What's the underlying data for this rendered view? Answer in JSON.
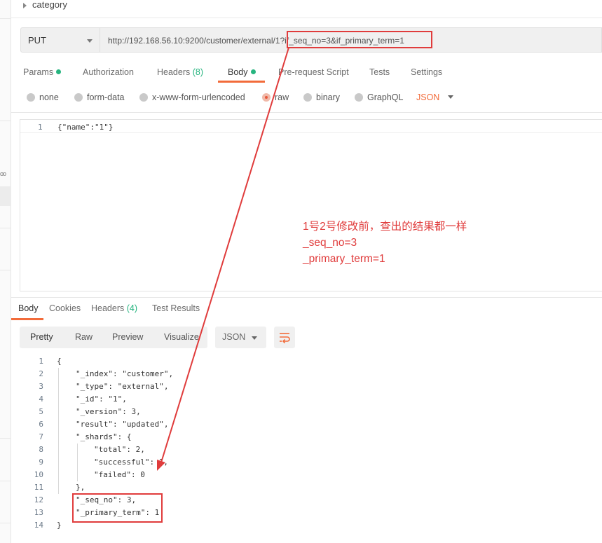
{
  "sidebar": {
    "collapsed_label": "oo"
  },
  "collection": {
    "label": "category"
  },
  "request": {
    "method": "PUT",
    "url": "http://192.168.56.10:9200/customer/external/1?if_seq_no=3&if_primary_term=1"
  },
  "request_tabs": [
    {
      "label": "Params",
      "dot": true
    },
    {
      "label": "Authorization"
    },
    {
      "label": "Headers",
      "count": "(8)"
    },
    {
      "label": "Body",
      "dot": true,
      "active": true
    },
    {
      "label": "Pre-request Script"
    },
    {
      "label": "Tests"
    },
    {
      "label": "Settings"
    }
  ],
  "body_types": {
    "none": "none",
    "form_data": "form-data",
    "urlencoded": "x-www-form-urlencoded",
    "raw": "raw",
    "binary": "binary",
    "graphql": "GraphQL",
    "format": "JSON",
    "selected": "raw"
  },
  "editor": {
    "line_number": "1",
    "code": "{\"name\":\"1\"}"
  },
  "annotation": {
    "line1": "1号2号修改前，查出的结果都一样",
    "line2": "_seq_no=3",
    "line3": "_primary_term=1",
    "color": "#e03c3c"
  },
  "response_tabs": {
    "body": "Body",
    "cookies": "Cookies",
    "headers": "Headers",
    "headers_count": "(4)",
    "test_results": "Test Results"
  },
  "response_toolbar": {
    "pretty": "Pretty",
    "raw": "Raw",
    "preview": "Preview",
    "visualize": "Visualize",
    "format": "JSON",
    "wrap_icon": "wrap-lines-icon"
  },
  "response_lines": [
    {
      "n": "1",
      "text": "{"
    },
    {
      "n": "2",
      "text": "\"_index\": \"customer\","
    },
    {
      "n": "3",
      "text": "\"_type\": \"external\","
    },
    {
      "n": "4",
      "text": "\"_id\": \"1\","
    },
    {
      "n": "5",
      "text": "\"_version\": 3,"
    },
    {
      "n": "6",
      "text": "\"result\": \"updated\","
    },
    {
      "n": "7",
      "text": "\"_shards\": {"
    },
    {
      "n": "8",
      "text": "\"total\": 2,"
    },
    {
      "n": "9",
      "text": "\"successful\": 1,"
    },
    {
      "n": "10",
      "text": "\"failed\": 0"
    },
    {
      "n": "11",
      "text": "},"
    },
    {
      "n": "12",
      "text": "\"_seq_no\": 3,"
    },
    {
      "n": "13",
      "text": "\"_primary_term\": 1"
    },
    {
      "n": "14",
      "text": "}"
    }
  ],
  "accent_colors": {
    "orange": "#f26b3a",
    "green": "#26b47f",
    "annotation_red": "#e03c3c"
  }
}
